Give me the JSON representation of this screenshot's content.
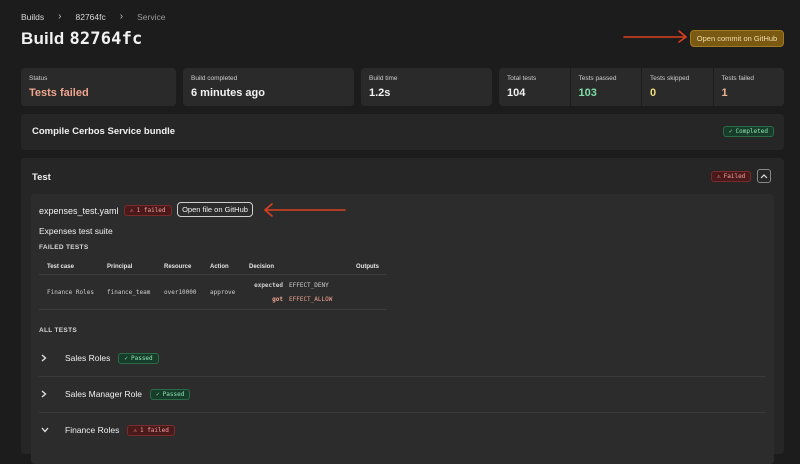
{
  "breadcrumb": {
    "builds": "Builds",
    "commit": "82764fc",
    "current": "Service"
  },
  "title": {
    "prefix": "Build",
    "hash": "82764fc"
  },
  "header_button": "Open commit on GitHub",
  "stats": {
    "status": {
      "label": "Status",
      "value": "Tests failed"
    },
    "completed": {
      "label": "Build completed",
      "value": "6 minutes ago"
    },
    "build_time": {
      "label": "Build time",
      "value": "1.2s"
    },
    "total": {
      "label": "Total tests",
      "value": "104"
    },
    "passed": {
      "label": "Tests passed",
      "value": "103"
    },
    "skipped": {
      "label": "Tests skipped",
      "value": "0"
    },
    "failed": {
      "label": "Tests failed",
      "value": "1"
    }
  },
  "compile_section": {
    "title": "Compile Cerbos Service bundle",
    "badge": "Completed"
  },
  "test_section": {
    "title": "Test",
    "badge": "Failed",
    "file": {
      "name": "expenses_test.yaml",
      "badge": "1 failed",
      "open_button": "Open file on GitHub",
      "suite": "Expenses test suite",
      "failed_heading": "FAILED TESTS",
      "columns": [
        "Test case",
        "Principal",
        "Resource",
        "Action",
        "Decision",
        "Outputs"
      ],
      "failed_row": {
        "test_case": "Finance Roles",
        "principal": "finance_team",
        "resource": "over10000",
        "action": "approve",
        "expected_label": "expected",
        "expected_value": "EFFECT_DENY",
        "got_label": "got",
        "got_value": "EFFECT_ALLOW"
      },
      "all_heading": "ALL TESTS",
      "tests": [
        {
          "name": "Sales Roles",
          "badge": "Passed"
        },
        {
          "name": "Sales Manager Role",
          "badge": "Passed"
        },
        {
          "name": "Finance Roles",
          "badge": "1 failed"
        }
      ]
    }
  },
  "colors": {
    "accent": "#7a5a12",
    "annotation": "#d9401f",
    "passed": "#7ddba6",
    "failed": "#f0a58f"
  }
}
